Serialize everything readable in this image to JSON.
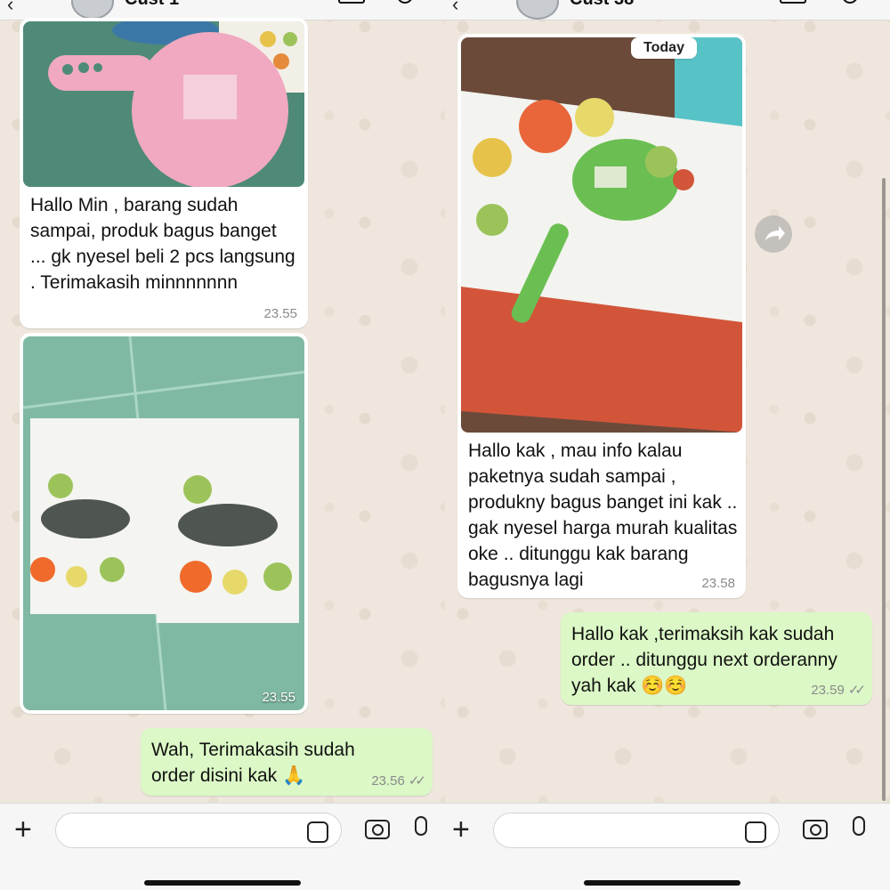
{
  "left": {
    "contact_name": "Cust 1",
    "messages": [
      {
        "type": "image-text",
        "text": "Hallo Min , barang sudah sampai, produk bagus banget ... gk nyesel beli 2 pcs langsung . Terimakasih minnnnnnn",
        "time": "23.55"
      },
      {
        "type": "image",
        "time": "23.55"
      },
      {
        "type": "text-out",
        "text": "Wah, Terimakasih sudah order disini kak 🙏",
        "time": "23.56"
      }
    ]
  },
  "right": {
    "contact_name": "Cust 38",
    "date_badge": "Today",
    "messages": [
      {
        "type": "image-text",
        "text": "Hallo kak , mau info kalau paketnya sudah sampai , produkny bagus banget ini kak .. gak nyesel harga murah kualitas oke .. ditunggu kak barang bagusnya lagi",
        "time": "23.58"
      },
      {
        "type": "text-out",
        "text": "Hallo kak ,terimaksih kak sudah order .. ditunggu next orderanny yah kak ☺️☺️",
        "time": "23.59"
      }
    ]
  },
  "icons": {
    "back": "chevron-left-icon",
    "video": "video-call-icon",
    "phone": "phone-icon",
    "forward": "forward-icon",
    "plus": "plus-icon",
    "sticker": "sticker-icon",
    "camera": "camera-icon",
    "mic": "microphone-icon"
  },
  "colors": {
    "background": "#efe7dd",
    "incoming_bubble": "#ffffff",
    "outgoing_bubble": "#dbf8c6",
    "timestamp": "#8a8a8a"
  }
}
